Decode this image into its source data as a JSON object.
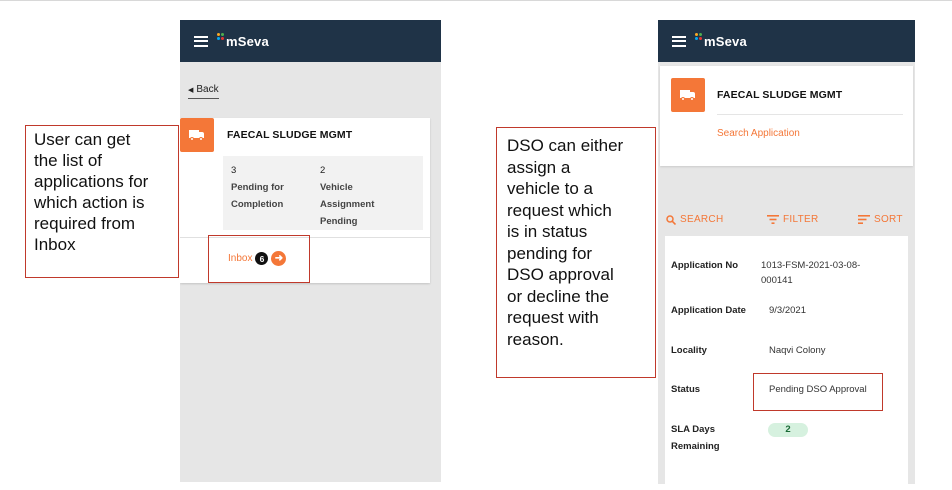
{
  "brand": {
    "name": "mSeva",
    "dot_colors": [
      "#f9a825",
      "#4caf50",
      "#03a9f4",
      "#e53935"
    ]
  },
  "colors": {
    "appbar": "#1f3347",
    "accent": "#f47738",
    "callout_border": "#c0392b"
  },
  "left_screen": {
    "back_label": "Back",
    "module_title": "FAECAL SLUDGE MGMT",
    "stats": [
      {
        "count": "3",
        "label_lines": [
          "Pending for",
          "Completion"
        ]
      },
      {
        "count": "2",
        "label_lines": [
          "Vehicle",
          "Assignment",
          "Pending"
        ]
      }
    ],
    "inbox_label": "Inbox",
    "inbox_count": "6",
    "icons": [
      "menu-icon",
      "truck-icon",
      "arrow-right-icon"
    ]
  },
  "right_screen": {
    "module_title": "FAECAL SLUDGE MGMT",
    "search_application_label": "Search Application",
    "toolbar": {
      "search_label": "SEARCH",
      "filter_label": "FILTER",
      "sort_label": "SORT"
    },
    "application": {
      "application_no_label": "Application No",
      "application_no_line1": "1013-FSM-2021-03-08-",
      "application_no_line2": "000141",
      "application_date_label": "Application Date",
      "application_date": "9/3/2021",
      "locality_label": "Locality",
      "locality": "Naqvi Colony",
      "status_label": "Status",
      "status": "Pending DSO Approval",
      "sla_label_line1": "SLA Days",
      "sla_label_line2": "Remaining",
      "sla_days": "2"
    },
    "icons": [
      "menu-icon",
      "truck-icon",
      "search-icon",
      "filter-icon",
      "sort-icon"
    ]
  },
  "callouts": {
    "left_lines": [
      "User can get",
      "the list of",
      "applications for",
      "which action is",
      "required from",
      "Inbox"
    ],
    "right_lines": [
      "DSO can either",
      "assign a",
      "vehicle to a",
      "request which",
      "is in status",
      "pending for",
      "DSO approval",
      "or decline the",
      "request with",
      "reason."
    ]
  }
}
